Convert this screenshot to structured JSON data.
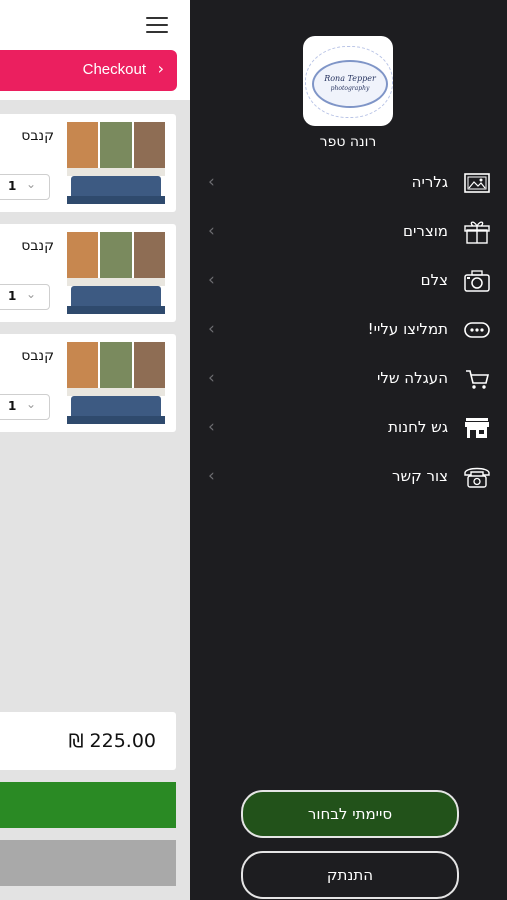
{
  "cart": {
    "checkout_label": "Checkout",
    "items": [
      {
        "title": "קנבס",
        "qty": "1"
      },
      {
        "title": "קנבס",
        "qty": "1"
      },
      {
        "title": "קנבס",
        "qty": "1"
      }
    ],
    "total": "₪ 225.00"
  },
  "drawer": {
    "user_name": "רונה טפר",
    "logo": {
      "line1": "Rona Tepper",
      "line2": "photography"
    },
    "menu": [
      {
        "label": "גלריה",
        "icon": "gallery-icon"
      },
      {
        "label": "מוצרים",
        "icon": "gift-box-icon"
      },
      {
        "label": "צלם",
        "icon": "camera-icon"
      },
      {
        "label": "תמליצו עליי!",
        "icon": "chat-bubble-icon"
      },
      {
        "label": "העגלה שלי",
        "icon": "cart-icon"
      },
      {
        "label": "גש לחנות",
        "icon": "store-icon"
      },
      {
        "label": "צור קשר",
        "icon": "phone-icon"
      }
    ],
    "done_button": "סיימתי לבחור",
    "logout_button": "התנתק"
  },
  "colors": {
    "accent_pink": "#eb1f5f",
    "drawer_bg": "#1d1d20",
    "done_green": "#22521a",
    "cart_green": "#2a8a24"
  }
}
